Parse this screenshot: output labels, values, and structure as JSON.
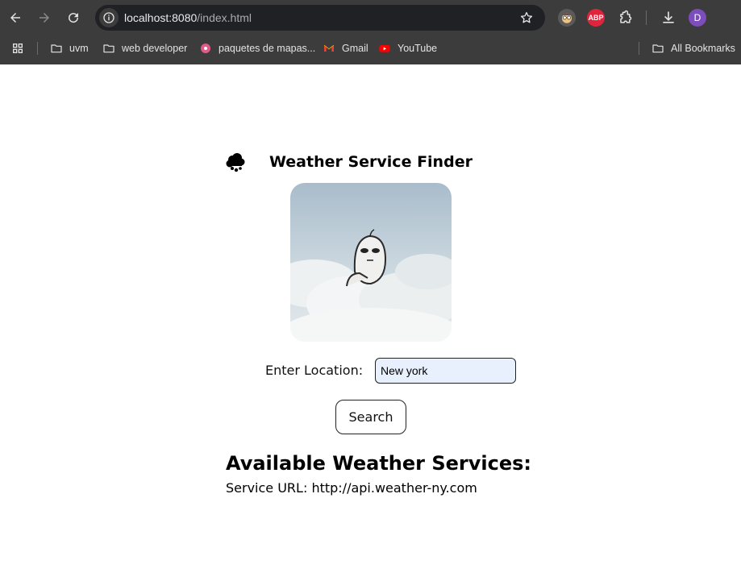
{
  "browser": {
    "url_host": "localhost:8080",
    "url_path": "/index.html",
    "profile_initial": "D",
    "abp_label": "ABP"
  },
  "bookmarks": {
    "items": [
      {
        "label": "uvm",
        "icon": "folder-icon"
      },
      {
        "label": "web developer",
        "icon": "folder-icon"
      },
      {
        "label": "paquetes de mapas...",
        "icon": "site-icon"
      },
      {
        "label": "Gmail",
        "icon": "gmail-icon"
      },
      {
        "label": "YouTube",
        "icon": "youtube-icon"
      }
    ],
    "all_bookmarks": "All Bookmarks"
  },
  "page": {
    "title": "Weather Service Finder",
    "location_label": "Enter Location:",
    "location_value": "New york",
    "search_button": "Search",
    "services_title": "Available Weather Services:",
    "service_line": "Service URL: http://api.weather-ny.com"
  },
  "colors": {
    "chrome_bg": "#3c3c3c",
    "omnibox_bg": "#202124",
    "input_bg": "#e8f0fe",
    "profile_bg": "#7c4dbb"
  }
}
